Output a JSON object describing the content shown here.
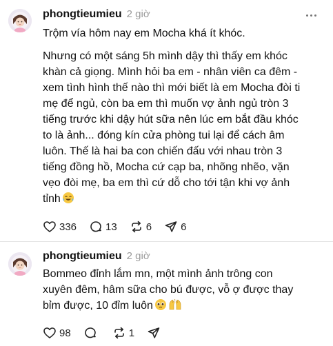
{
  "posts": [
    {
      "username": "phongtieumieu",
      "time": "2 giờ",
      "paragraphs": [
        [
          "Trộm vía hôm nay em Mocha khá ít khóc."
        ],
        [
          "Nhưng có một sáng 5h mình dậy thì thấy em khóc",
          "khàn cả giọng. Mình hỏi ba em - nhân viên ca đêm -",
          "xem tình hình thế nào thì mới biết là em Mocha đòi ti",
          "mẹ để ngủ, còn ba em thì muốn vợ ảnh ngủ tròn 3",
          "tiếng trước khi dậy hút sữa nên lúc em bắt đầu khóc",
          "to là ảnh... đóng kín cửa phòng tui lại để cách âm",
          "luôn. Thế là hai ba con chiến đấu với nhau tròn 3",
          "tiếng đồng hồ, Mocha cứ cạp ba, nhõng nhẽo, vặn",
          "vẹo đòi mẹ, ba em thì cứ dỗ cho tới tận khi vợ ảnh",
          "tỉnh"
        ]
      ],
      "emojis": [
        "tears-of-joy"
      ],
      "likes": "336",
      "comments": "13",
      "reposts": "6",
      "shares": "6"
    },
    {
      "username": "phongtieumieu",
      "time": "2 giờ",
      "paragraphs": [
        [
          "Bommeo đỉnh lắm mn, một mình ảnh trông con",
          "xuyên đêm, hâm sữa cho bú được, vỗ ợ được thay",
          "bỉm được, 10 đỉm luôn"
        ]
      ],
      "emojis": [
        "pleading-face",
        "raising-hands"
      ],
      "likes": "98",
      "comments": "",
      "reposts": "1",
      "shares": ""
    }
  ]
}
